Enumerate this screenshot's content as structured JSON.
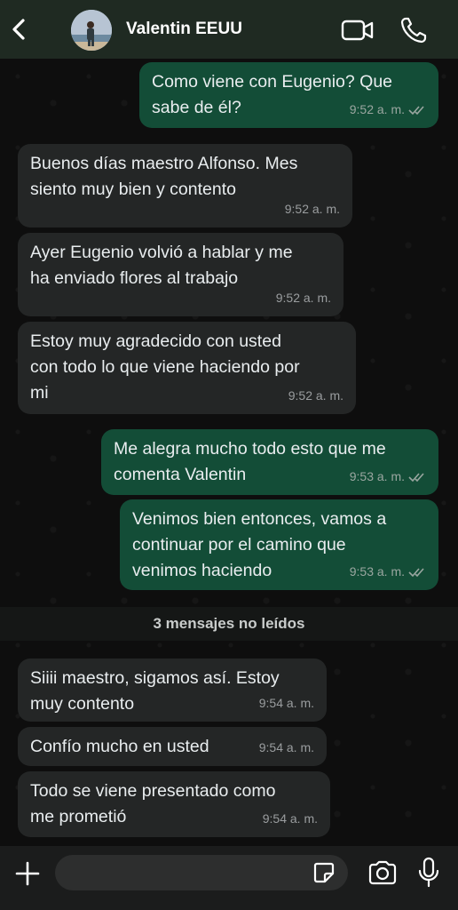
{
  "header": {
    "contact_name": "Valentin EEUU"
  },
  "messages": [
    {
      "direction": "out",
      "text_lines": [
        "Como viene con Eugenio? Que",
        "sabe de él?"
      ],
      "time": "9:52 a. m.",
      "read": true
    },
    {
      "direction": "in",
      "text_lines": [
        "Buenos días maestro Alfonso. Mes",
        "siento muy bien y contento"
      ],
      "time": "9:52 a. m."
    },
    {
      "direction": "in",
      "text_lines": [
        "Ayer Eugenio volvió a hablar y me",
        "ha enviado flores al trabajo"
      ],
      "time": "9:52 a. m."
    },
    {
      "direction": "in",
      "text_lines": [
        "Estoy muy agradecido con usted",
        "con todo lo que viene haciendo por",
        "mi"
      ],
      "time": "9:52 a. m."
    },
    {
      "direction": "out",
      "text_lines": [
        "Me alegra mucho todo esto que me",
        "comenta Valentin"
      ],
      "time": "9:53 a. m.",
      "read": true
    },
    {
      "direction": "out",
      "text_lines": [
        "Venimos bien entonces, vamos a",
        "continuar por el camino que",
        "venimos haciendo"
      ],
      "time": "9:53 a. m.",
      "read": true
    },
    {
      "direction": "in",
      "text_lines": [
        "Siiii maestro, sigamos así. Estoy",
        "muy contento"
      ],
      "time": "9:54 a. m."
    },
    {
      "direction": "in",
      "text_lines": [
        "Confío mucho en usted"
      ],
      "time": "9:54 a. m."
    },
    {
      "direction": "in",
      "text_lines": [
        "Todo se viene presentado como",
        "me prometió"
      ],
      "time": "9:54 a. m."
    }
  ],
  "unread_divider": "3 mensajes no leídos",
  "composer": {
    "placeholder": ""
  },
  "colors": {
    "outgoing_bubble": "#134d37",
    "incoming_bubble": "#242626",
    "header_bg": "#1f2a22"
  }
}
